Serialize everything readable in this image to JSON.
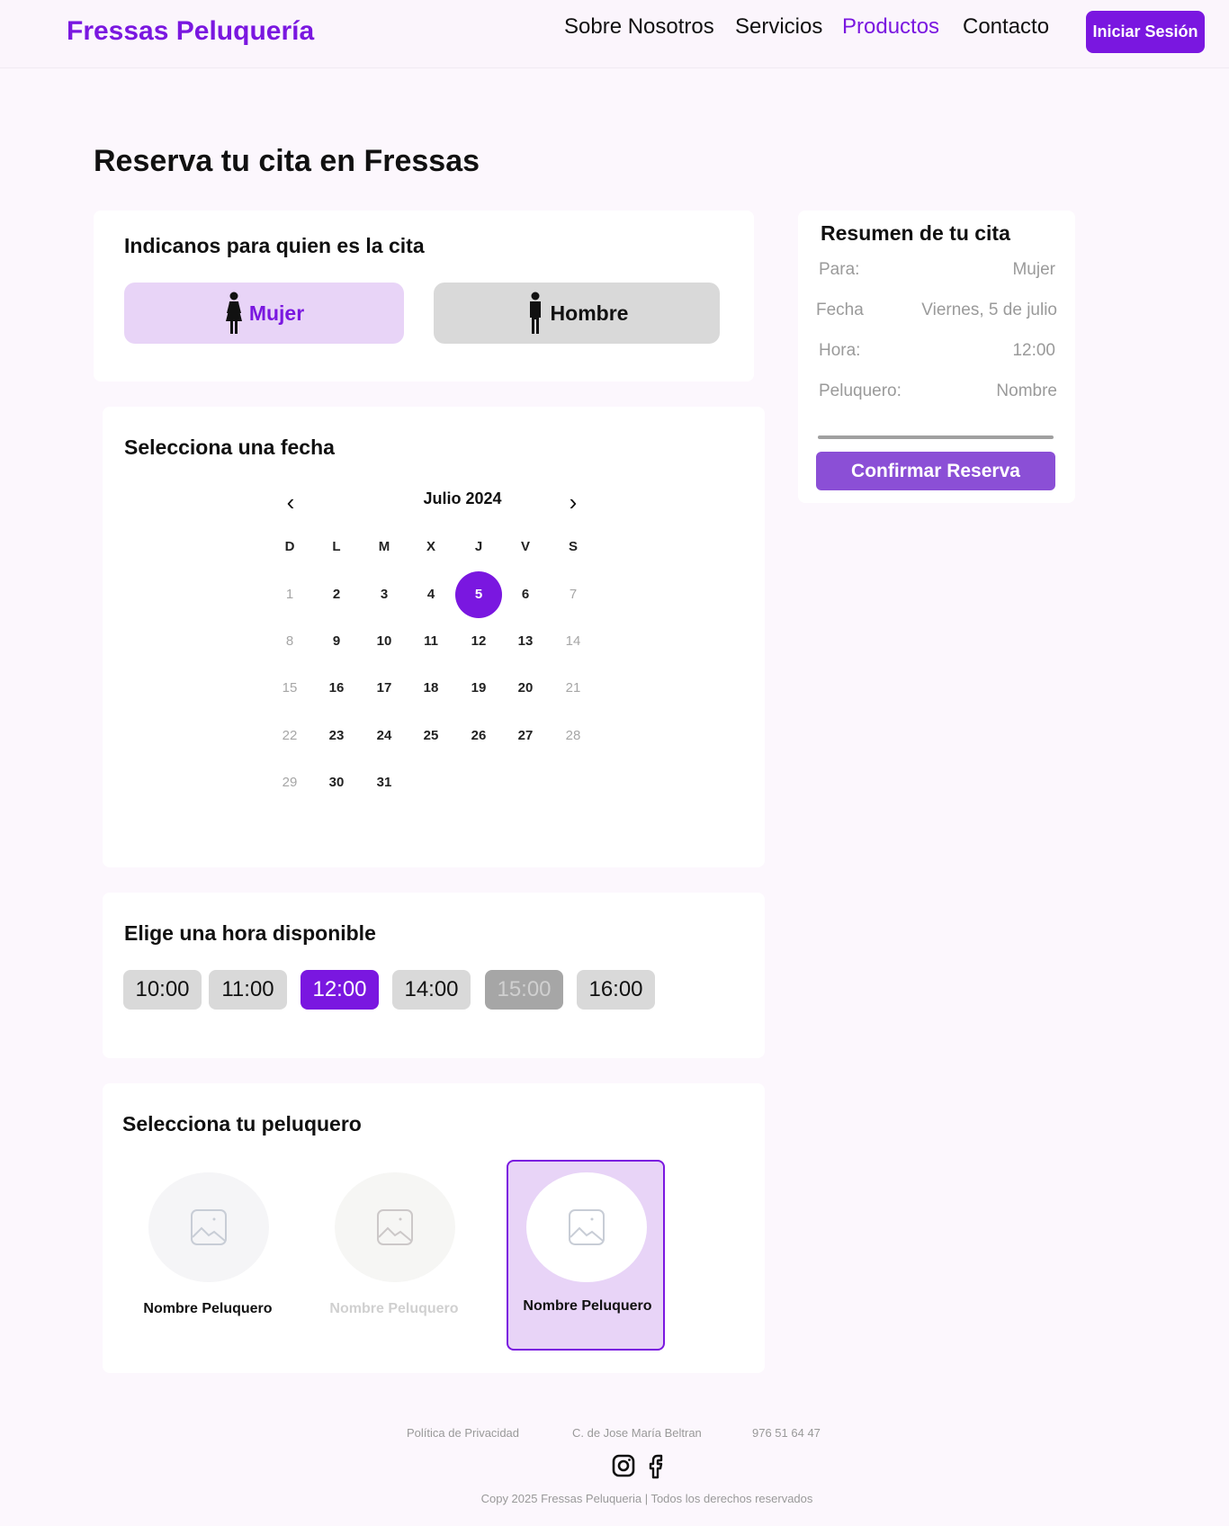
{
  "header": {
    "brand": "Fressas Peluquería",
    "nav": [
      "Sobre Nosotros",
      "Servicios",
      "Productos",
      "Contacto"
    ],
    "active_nav": "Productos",
    "login_label": "Iniciar Sesión"
  },
  "page_title": "Reserva tu cita en Fressas",
  "gender": {
    "title": "Indicanos para quien es la cita",
    "female_label": "Mujer",
    "male_label": "Hombre",
    "selected": "Mujer"
  },
  "calendar": {
    "title": "Selecciona una fecha",
    "month_label": "Julio 2024",
    "weekdays": [
      "D",
      "L",
      "M",
      "X",
      "J",
      "V",
      "S"
    ],
    "days": [
      "1",
      "2",
      "3",
      "4",
      "5",
      "6",
      "7",
      "8",
      "9",
      "10",
      "11",
      "12",
      "13",
      "14",
      "15",
      "16",
      "17",
      "18",
      "19",
      "20",
      "21",
      "22",
      "23",
      "24",
      "25",
      "26",
      "27",
      "28",
      "29",
      "30",
      "31"
    ],
    "selected_day": "5"
  },
  "time": {
    "title": "Elige una hora disponible",
    "slots": [
      "10:00",
      "11:00",
      "12:00",
      "14:00",
      "15:00",
      "16:00"
    ],
    "selected": "12:00",
    "disabled": [
      "15:00"
    ]
  },
  "stylists": {
    "title": "Selecciona tu peluquero",
    "items": [
      {
        "name": "Nombre Peluquero",
        "state": "normal"
      },
      {
        "name": "Nombre Peluquero",
        "state": "dim"
      },
      {
        "name": "Nombre Peluquero",
        "state": "selected"
      }
    ]
  },
  "summary": {
    "title": "Resumen de tu cita",
    "rows": [
      {
        "label": "Para:",
        "value": "Mujer"
      },
      {
        "label": "Fecha",
        "value": "Viernes, 5 de julio"
      },
      {
        "label": "Hora:",
        "value": "12:00"
      },
      {
        "label": "Peluquero:",
        "value": "Nombre"
      }
    ],
    "confirm_label": "Confirmar Reserva"
  },
  "footer": {
    "privacy": "Política de Privacidad",
    "address": "C. de Jose María Beltran",
    "phone": "976 51 64 47",
    "copyright": "Copy 2025 Fressas Peluqueria | Todos los derechos reservados",
    "icons": [
      "instagram-icon",
      "facebook-icon"
    ]
  },
  "colors": {
    "accent": "#7a17e0",
    "accent_light": "#e8d4f7",
    "confirm": "#8b4fd6",
    "background": "#fcf7fd"
  }
}
